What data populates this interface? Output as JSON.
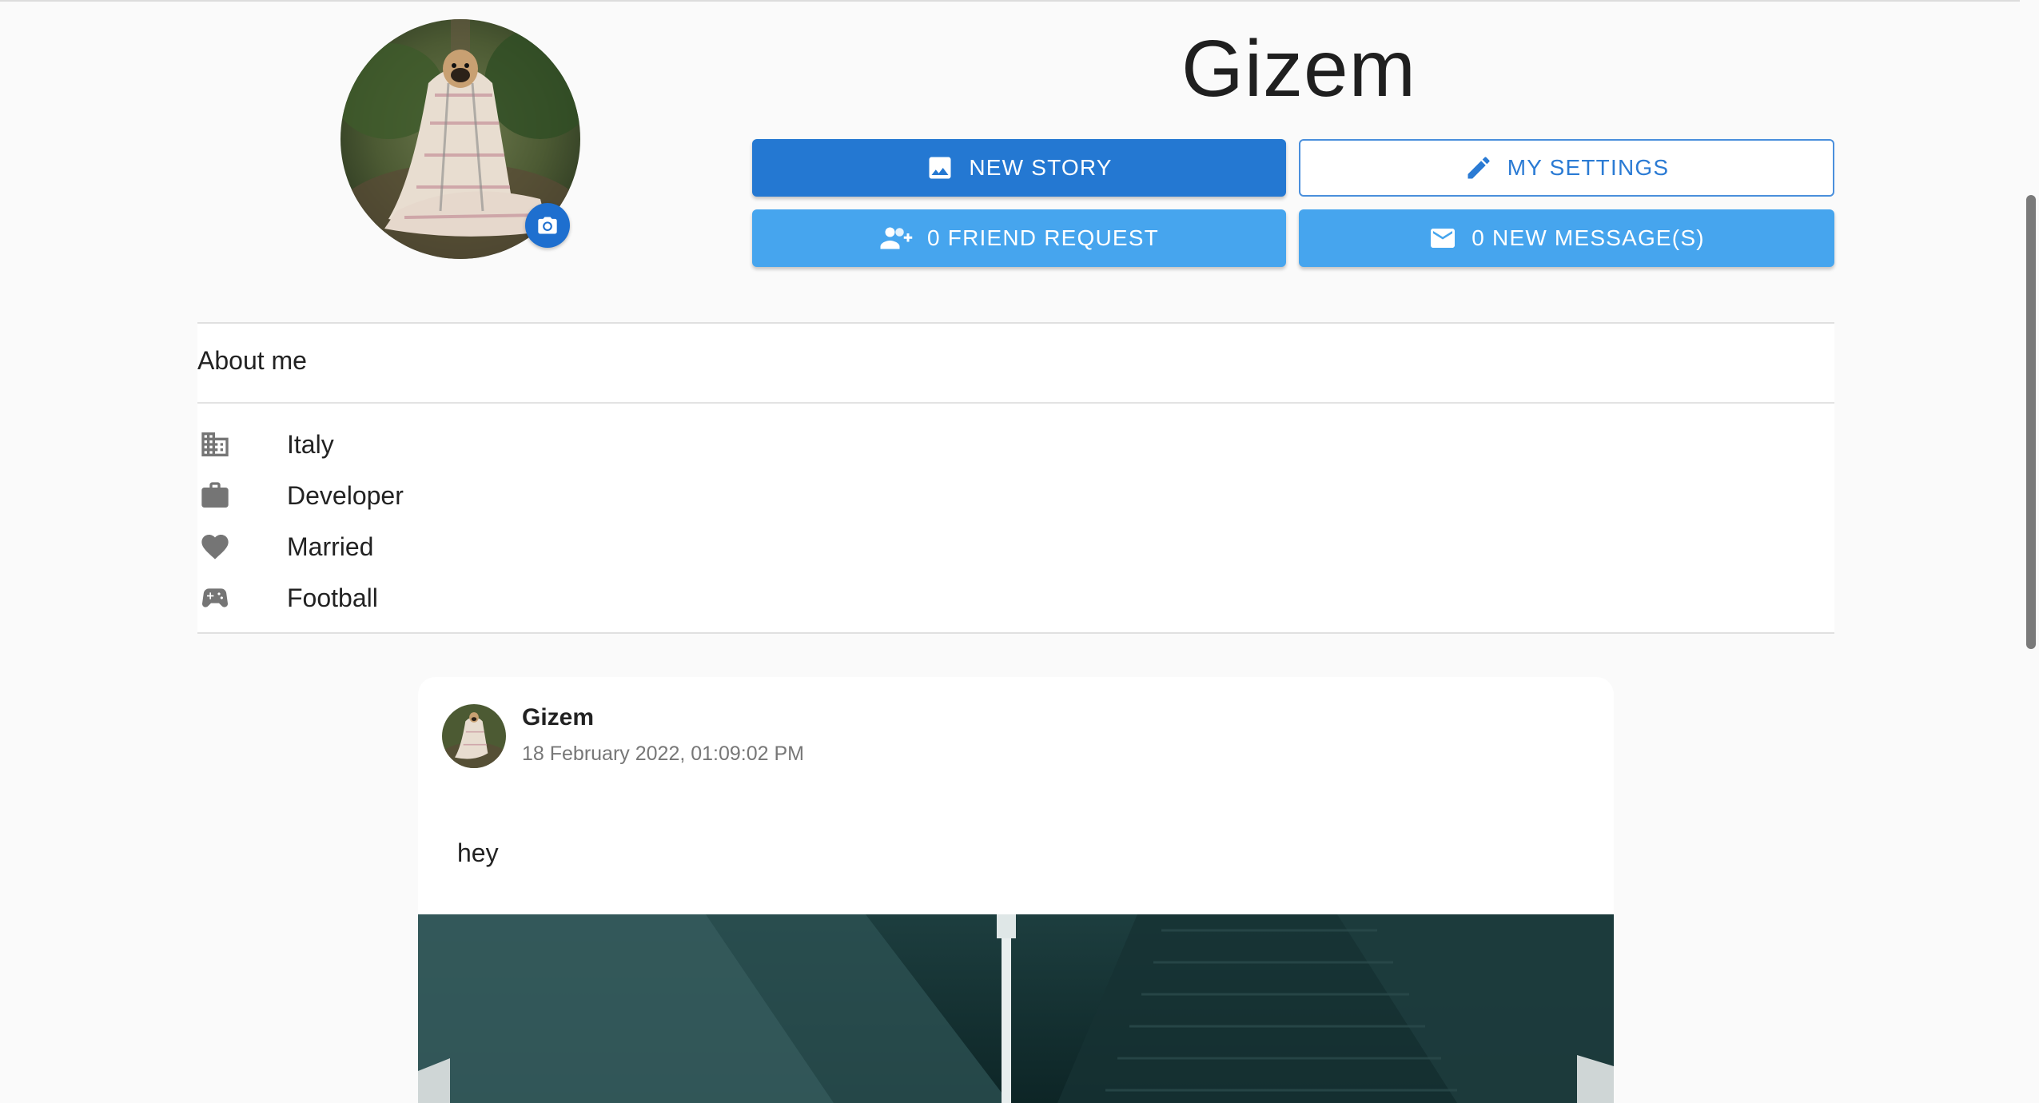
{
  "profile": {
    "name": "Gizem",
    "avatar_icon": "profile-photo-pug-in-blanket",
    "change_photo_icon": "camera-icon"
  },
  "actions": {
    "new_story": {
      "label": "NEW STORY",
      "icon": "image-icon"
    },
    "my_settings": {
      "label": "MY SETTINGS",
      "icon": "pencil-icon"
    },
    "friend_request": {
      "label": "0 FRIEND REQUEST",
      "icon": "person-add-icon"
    },
    "new_messages": {
      "label": "0 NEW MESSAGE(S)",
      "icon": "mail-icon"
    }
  },
  "about": {
    "title": "About me",
    "items": [
      {
        "icon": "building-icon",
        "label": "Italy"
      },
      {
        "icon": "briefcase-icon",
        "label": "Developer"
      },
      {
        "icon": "heart-icon",
        "label": "Married"
      },
      {
        "icon": "gamepad-icon",
        "label": "Football"
      }
    ]
  },
  "post": {
    "author": "Gizem",
    "date": "18 February 2022, 01:09:02 PM",
    "text": "hey",
    "image_icon": "post-photo-architecture"
  },
  "colors": {
    "primary": "#2478d2",
    "light_blue": "#46a5ee",
    "outline_text": "#2b7bd4",
    "icon_grey": "#757575"
  }
}
